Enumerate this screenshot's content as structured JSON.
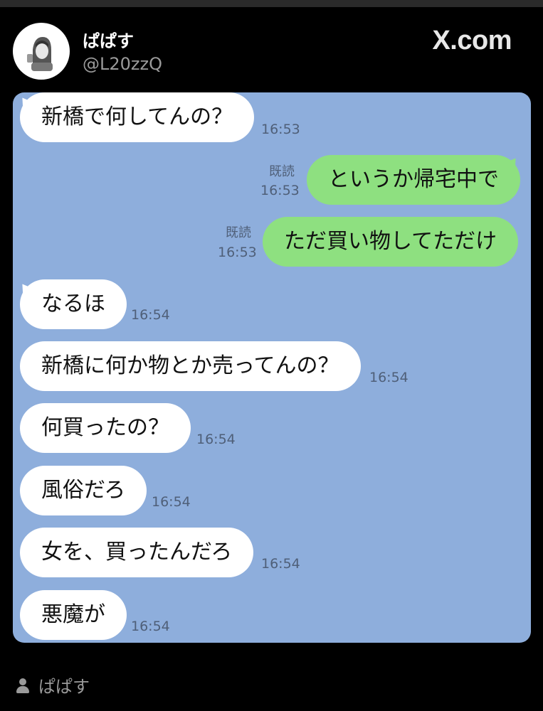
{
  "profile": {
    "display_name": "ぱぱす",
    "handle": "@L20zzQ",
    "site_logo": "X.com",
    "avatar_icon": "illustrated-person-avatar-icon"
  },
  "chat": {
    "background_color": "#8eaedc",
    "messages": [
      {
        "side": "in",
        "text": "新橋で何してんの？",
        "time": "16:53",
        "read": ""
      },
      {
        "side": "out",
        "text": "というか帰宅中で",
        "time": "16:53",
        "read": "既読"
      },
      {
        "side": "out",
        "text": "ただ買い物してただけ",
        "time": "16:53",
        "read": "既読"
      },
      {
        "side": "in",
        "text": "なるほ",
        "time": "16:54",
        "read": ""
      },
      {
        "side": "in",
        "text": "新橋に何か物とか売ってんの？",
        "time": "16:54",
        "read": ""
      },
      {
        "side": "in",
        "text": "何買ったの？",
        "time": "16:54",
        "read": ""
      },
      {
        "side": "in",
        "text": "風俗だろ",
        "time": "16:54",
        "read": ""
      },
      {
        "side": "in",
        "text": "女を、買ったんだろ",
        "time": "16:54",
        "read": ""
      },
      {
        "side": "in",
        "text": "悪魔が",
        "time": "16:54",
        "read": ""
      }
    ]
  },
  "footer": {
    "user_icon": "person-icon",
    "name": "ぱぱす"
  }
}
